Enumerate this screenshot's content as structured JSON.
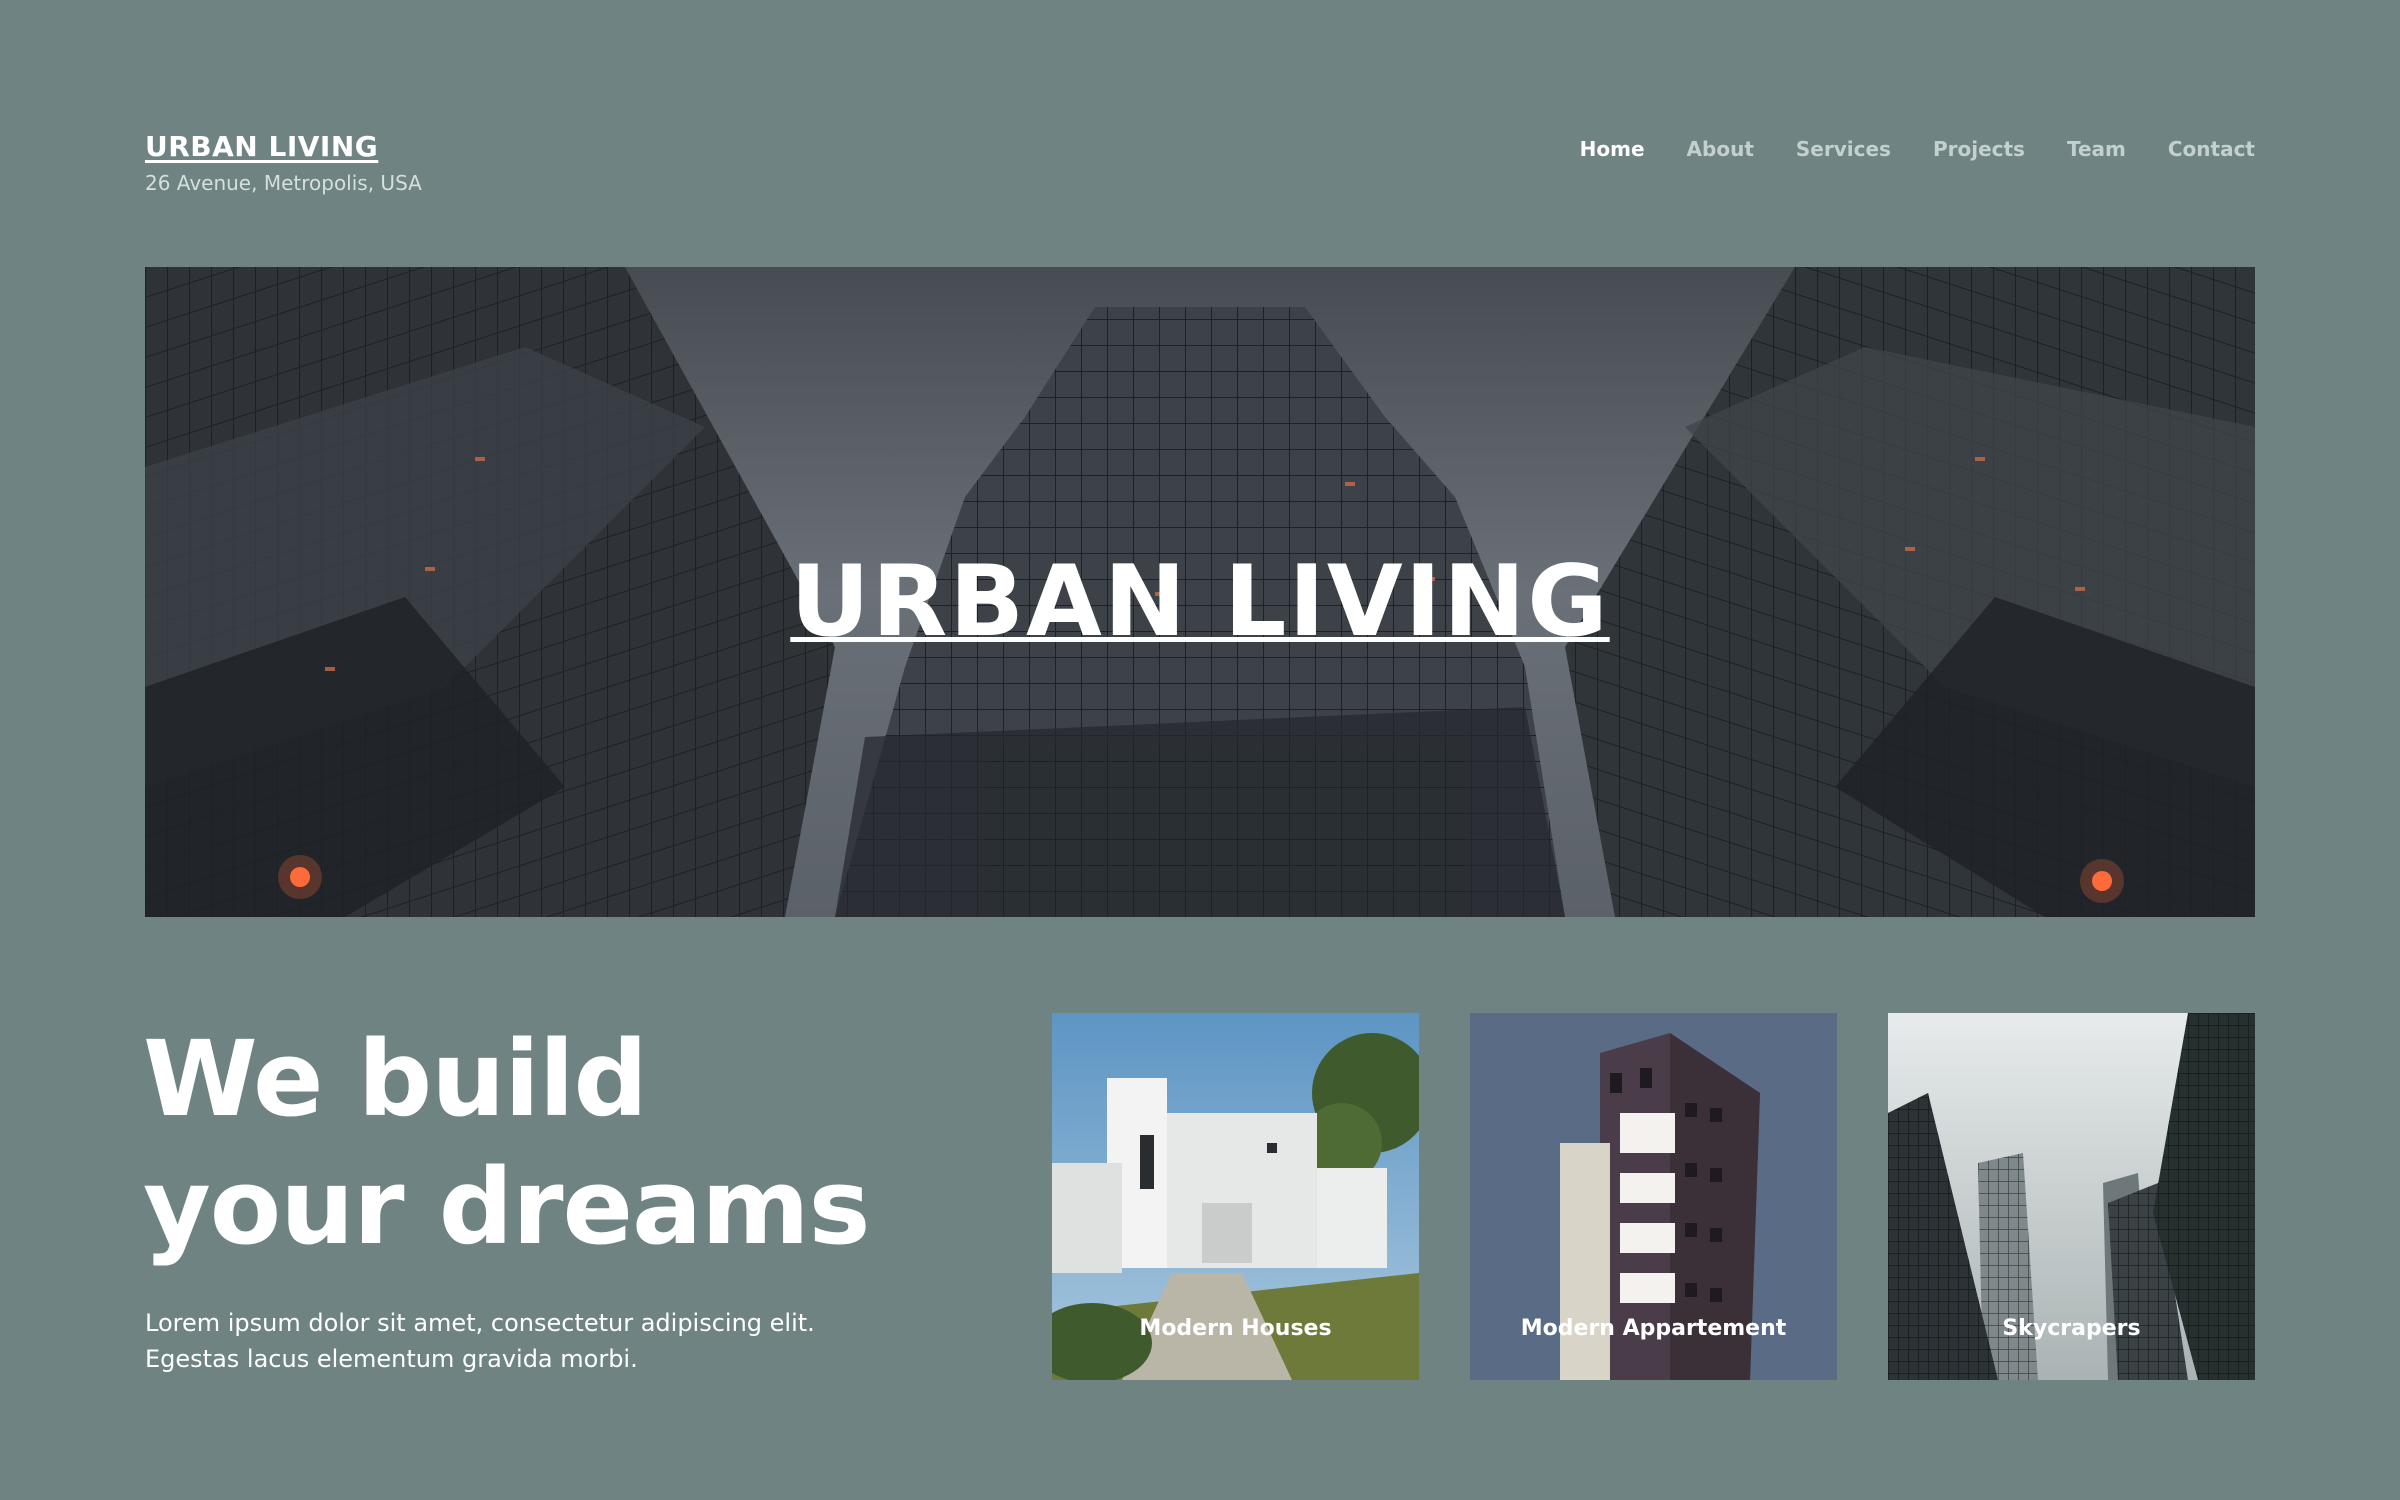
{
  "header": {
    "site_title": "URBAN LIVING",
    "address": "26 Avenue, Metropolis, USA"
  },
  "nav": {
    "items": [
      "Home",
      "About",
      "Services",
      "Projects",
      "Team",
      "Contact"
    ],
    "active": "Home"
  },
  "hero": {
    "title": "URBAN LIVING"
  },
  "intro": {
    "headline_line1": "We build",
    "headline_line2": "your dreams",
    "body_line1": "Lorem ipsum dolor sit amet, consectetur adipiscing elit.",
    "body_line2": "Egestas lacus elementum gravida morbi."
  },
  "cards": [
    {
      "label": "Modern Houses"
    },
    {
      "label": "Modern Appartement"
    },
    {
      "label": "Skycrapers"
    }
  ],
  "colors": {
    "page_background": "#6e8382",
    "text": "#ffffff",
    "nav_inactive": "#c4d0cf"
  }
}
